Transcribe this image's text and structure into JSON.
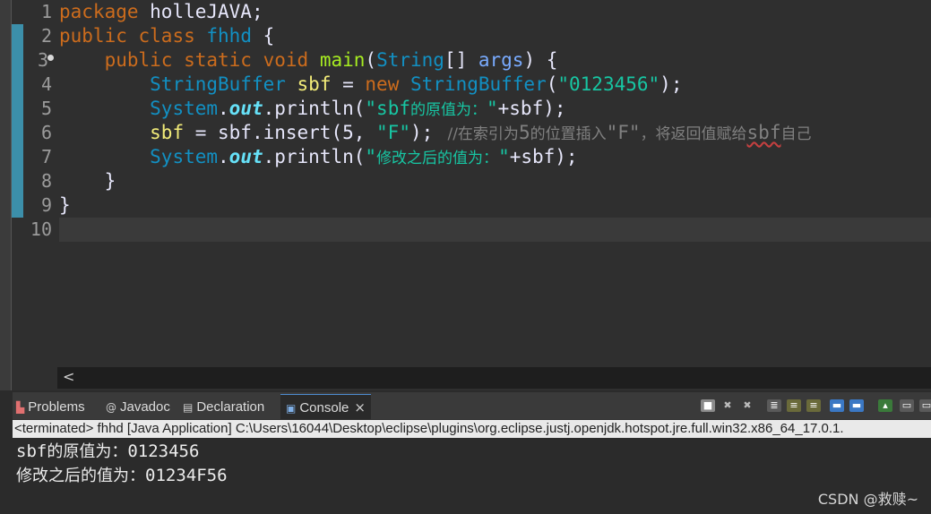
{
  "editor": {
    "line_numbers": [
      "1",
      "2",
      "3",
      "4",
      "5",
      "6",
      "7",
      "8",
      "9",
      "10"
    ],
    "lines": [
      {
        "kw1": "package",
        "rest": " holleJAVA;"
      },
      {
        "kw1": "public",
        "kw2": "class",
        "cls": "fhhd",
        "rest": " {"
      },
      {
        "kw1": "public",
        "kw2": "static",
        "kw3": "void",
        "method": "main",
        "p1": "(",
        "type": "String",
        "p2": "[] ",
        "arg": "args",
        "p3": ") {"
      },
      {
        "type1": "StringBuffer",
        "var": "sbf",
        "eq": " = ",
        "kw": "new",
        "type2": "StringBuffer",
        "p1": "(",
        "str": "\"0123456\"",
        "p2": ");"
      },
      {
        "sys": "System",
        "dot1": ".",
        "field": "out",
        "dot2": ".println(",
        "str_open": "\"sbf",
        "str_cjk": "的原值为：",
        "str_close": "\"",
        "rest": "+sbf);"
      },
      {
        "var": "sbf",
        "rest1": " = sbf.insert(5, ",
        "str": "\"F\"",
        "rest2": ");",
        "comment_a": "   //在索引为",
        "comment_b": "5",
        "comment_c": "的位置插入",
        "comment_d": "\"F\"",
        "comment_e": "，将返回值赋给",
        "comment_f": "sbf",
        "comment_g": "自己"
      },
      {
        "sys": "System",
        "dot1": ".",
        "field": "out",
        "dot2": ".println(",
        "str_open": "\"",
        "str_cjk": "修改之后的值为：",
        "str_close": "\"",
        "rest": "+sbf);"
      },
      {
        "text": "}"
      },
      {
        "text": "}"
      },
      {
        "text": ""
      }
    ]
  },
  "console": {
    "tabs": [
      {
        "label": "Problems",
        "icon": "problems-icon"
      },
      {
        "label": "Javadoc",
        "icon": "javadoc-icon"
      },
      {
        "label": "Declaration",
        "icon": "declaration-icon"
      },
      {
        "label": "Console",
        "icon": "console-icon",
        "active": true
      }
    ],
    "terminated_line": "<terminated> fhhd [Java Application] C:\\Users\\16044\\Desktop\\eclipse\\plugins\\org.eclipse.justj.openjdk.hotspot.jre.full.win32.x86_64_17.0.1.",
    "output": [
      {
        "prefix": "sbf",
        "cjk": "的原值为：",
        "value": "0123456"
      },
      {
        "prefix": "",
        "cjk": "修改之后的值为：",
        "value": "01234F56"
      }
    ]
  },
  "watermark": "CSDN @救赎~",
  "scroll_arrow": "<",
  "close_glyph": "×"
}
